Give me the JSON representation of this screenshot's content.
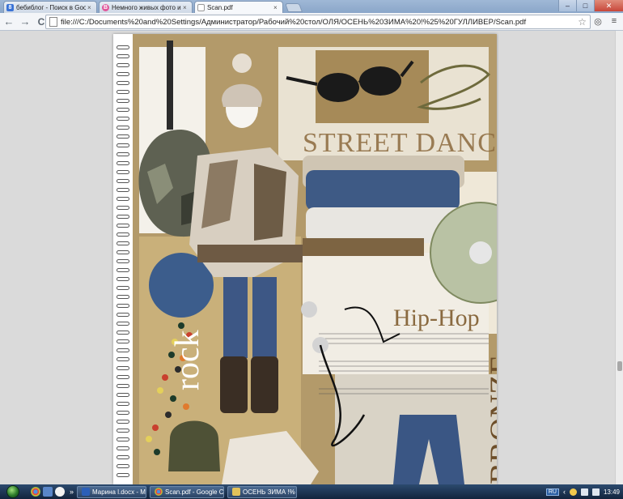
{
  "tabs": [
    {
      "label": "бебиблог - Поиск в Google",
      "favicon_color": "#3a73d6",
      "favicon_glyph": "8"
    },
    {
      "label": "Немного живых фото из ...",
      "favicon_color": "#e0569a",
      "favicon_glyph": "B"
    },
    {
      "label": "Scan.pdf",
      "favicon_color": "#f0f0f0",
      "favicon_glyph": ""
    }
  ],
  "tab_close_glyph": "×",
  "window_controls": {
    "minimize": "–",
    "maximize": "□",
    "close": "✕"
  },
  "toolbar": {
    "back": "←",
    "forward": "→",
    "reload": "C",
    "url": "file:///C:/Documents%20and%20Settings/Администратор/Рабочий%20стол/ОЛЯ/ОСЕНЬ%20ЗИМА%20!%25%20ГУЛЛИВЕР/Scan.pdf",
    "bookmark_star": "☆",
    "extension_icon": "◎",
    "menu_icon": "≡"
  },
  "document": {
    "street_dance": "STREET DANCE",
    "hip_hop": "Hip-Hop",
    "rock": "rock",
    "bronze": "BRONZE"
  },
  "taskbar": {
    "tasks": [
      {
        "label": "Марина l.docx - Mi...",
        "icon_color": "#2b5fb8"
      },
      {
        "label": "Scan.pdf - Google C...",
        "icon_color": "#e8b63a"
      },
      {
        "label": "ОСЕНЬ ЗИМА !% Г...",
        "icon_color": "#e2c25a"
      }
    ],
    "lang": "RU",
    "clock": "13:49",
    "overflow_glyph": "»"
  }
}
